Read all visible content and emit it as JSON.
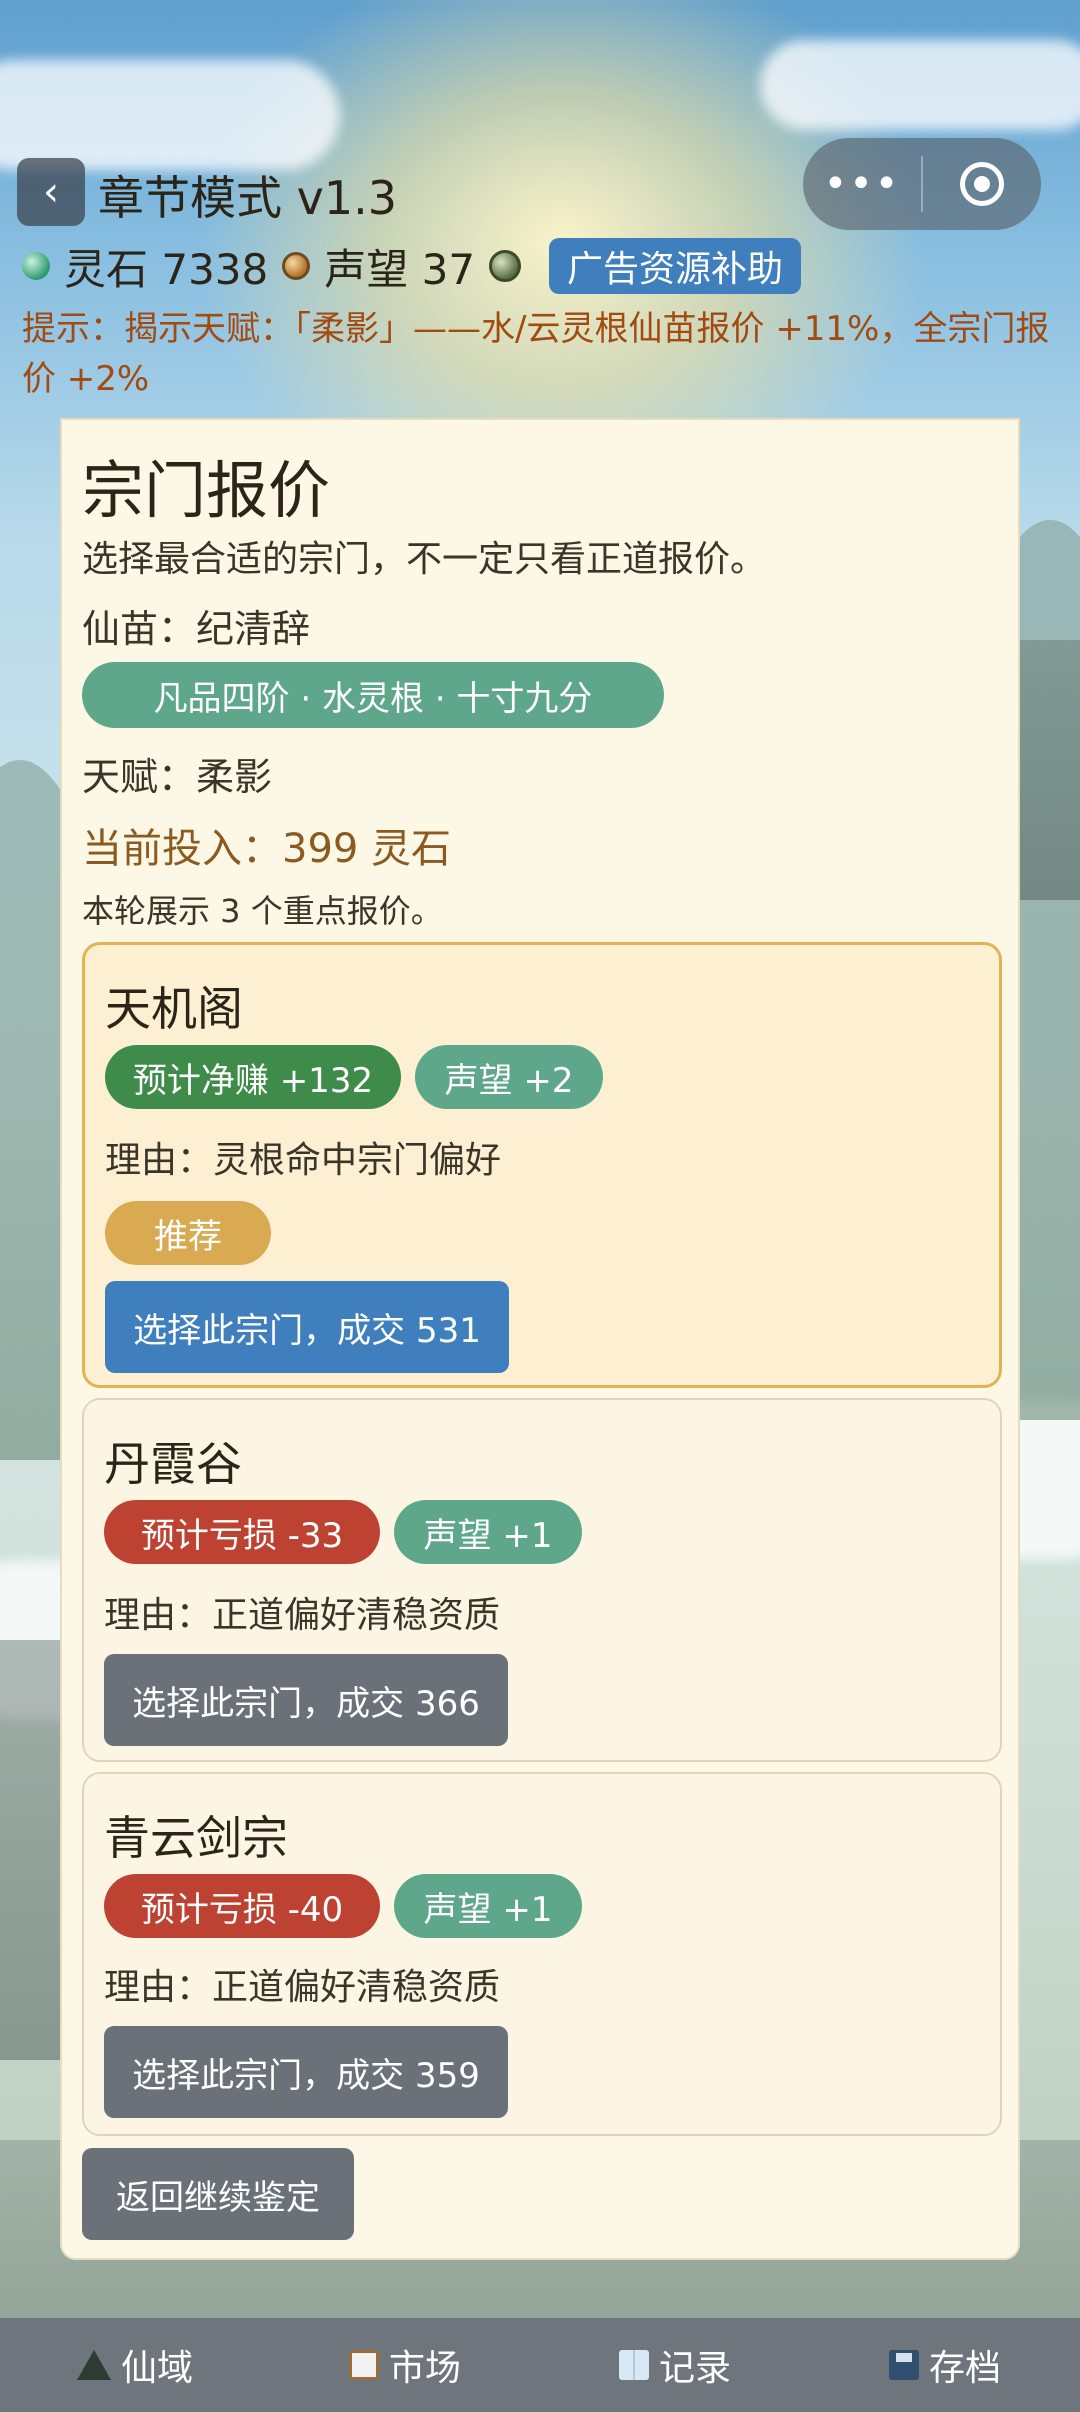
{
  "header": {
    "back_glyph": "‹",
    "title": "章节模式 v1.3",
    "capsule_more": "•••"
  },
  "resources": {
    "spirit_stone_label": "灵石 7338",
    "reputation_label": "声望 37",
    "ad_button": "广告资源补助"
  },
  "hint": "提示：揭示天赋：「柔影」——水/云灵根仙苗报价 +11%，全宗门报价 +2%",
  "panel": {
    "title": "宗门报价",
    "description": "选择最合适的宗门，不一定只看正道报价。",
    "seedling": "仙苗：纪清辞",
    "tag": "凡品四阶 · 水灵根 · 十寸九分",
    "talent": "天赋：柔影",
    "investment": "当前投入：399 灵石",
    "round_note": "本轮展示 3 个重点报价。"
  },
  "offers": [
    {
      "name": "天机阁",
      "profit": "预计净赚 +132",
      "reputation": "声望 +2",
      "reason": "理由：灵根命中宗门偏好",
      "recommend": "推荐",
      "button": "选择此宗门，成交 531"
    },
    {
      "name": "丹霞谷",
      "profit": "预计亏损 -33",
      "reputation": "声望 +1",
      "reason": "理由：正道偏好清稳资质",
      "button": "选择此宗门，成交 366"
    },
    {
      "name": "青云剑宗",
      "profit": "预计亏损 -40",
      "reputation": "声望 +1",
      "reason": "理由：正道偏好清稳资质",
      "button": "选择此宗门，成交 359"
    }
  ],
  "return_button": "返回继续鉴定",
  "nav": [
    {
      "label": "仙域",
      "icon": "mountain-icon"
    },
    {
      "label": "市场",
      "icon": "clipboard-icon"
    },
    {
      "label": "记录",
      "icon": "book-icon"
    },
    {
      "label": "存档",
      "icon": "floppy-disk-icon"
    }
  ],
  "colors": {
    "primary_button": "#3f7fbe",
    "neutral_button": "#6b7178",
    "gain": "#3e8b4a",
    "loss": "#bd4232",
    "reputation": "#5fa78b",
    "recommend": "#d9aa52",
    "hint_text": "#a14a12"
  }
}
